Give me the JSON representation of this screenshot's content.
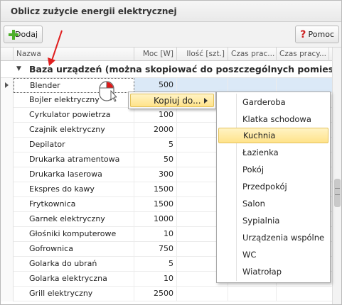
{
  "window": {
    "title": "Oblicz zużycie energii elektrycznej"
  },
  "toolbar": {
    "add_label": "Dodaj",
    "help_label": "Pomoc"
  },
  "grid": {
    "columns": [
      "Nazwa",
      "Moc [W]",
      "Ilość [szt.]",
      "Czas prac...",
      "Czas pracy..."
    ],
    "group_title": "Baza urządzeń (można skopiować do poszczególnych pomieszcze",
    "rows": [
      {
        "name": "Blender",
        "moc": "500"
      },
      {
        "name": "Bojler elektryczny",
        "moc": ""
      },
      {
        "name": "Cyrkulator powietrza",
        "moc": "100"
      },
      {
        "name": "Czajnik elektryczny",
        "moc": "2000"
      },
      {
        "name": "Depilator",
        "moc": "5"
      },
      {
        "name": "Drukarka atramentowa",
        "moc": "50"
      },
      {
        "name": "Drukarka laserowa",
        "moc": "300"
      },
      {
        "name": "Ekspres do kawy",
        "moc": "1500"
      },
      {
        "name": "Frytkownica",
        "moc": "1500"
      },
      {
        "name": "Garnek elektryczny",
        "moc": "1000"
      },
      {
        "name": "Głośniki komputerowe",
        "moc": "10"
      },
      {
        "name": "Gofrownica",
        "moc": "750"
      },
      {
        "name": "Golarka do ubrań",
        "moc": "5"
      },
      {
        "name": "Golarka elektryczna",
        "moc": "10"
      },
      {
        "name": "Grill elektryczny",
        "moc": "2500"
      }
    ]
  },
  "context_menu": {
    "item": "Kopiuj do..."
  },
  "submenu": {
    "items": [
      "Garderoba",
      "Klatka schodowa",
      "Kuchnia",
      "Łazienka",
      "Pokój",
      "Przedpokój",
      "Salon",
      "Sypialnia",
      "Urządzenia wspólne",
      "WC",
      "Wiatrołap"
    ],
    "highlighted": "Kuchnia"
  },
  "colors": {
    "highlight": "#ffe38a",
    "selection": "#dbe9f7",
    "arrow": "#e02020"
  }
}
